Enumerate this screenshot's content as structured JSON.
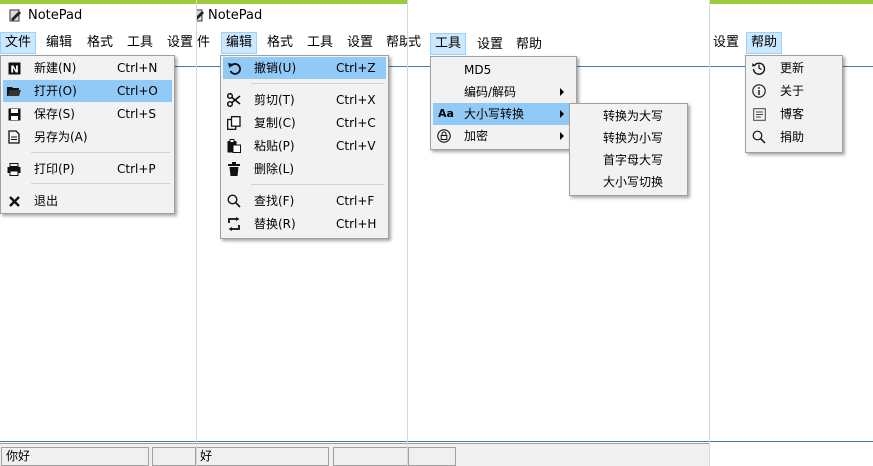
{
  "app": {
    "title": "NotePad",
    "status": "你好",
    "status_short": "好"
  },
  "menubar": {
    "file": "文件",
    "edit": "编辑",
    "format": "格式",
    "tools": "工具",
    "settings": "设置",
    "help": "帮助",
    "file_cut": "件",
    "format_cut": "式",
    "help_cut": "帮耳"
  },
  "file_menu": {
    "new": {
      "label": "新建(N)",
      "shortcut": "Ctrl+N"
    },
    "open": {
      "label": "打开(O)",
      "shortcut": "Ctrl+O"
    },
    "save": {
      "label": "保存(S)",
      "shortcut": "Ctrl+S"
    },
    "save_as": {
      "label": "另存为(A)"
    },
    "print": {
      "label": "打印(P)",
      "shortcut": "Ctrl+P"
    },
    "exit": {
      "label": "退出"
    }
  },
  "edit_menu": {
    "undo": {
      "label": "撤销(U)",
      "shortcut": "Ctrl+Z"
    },
    "cut": {
      "label": "剪切(T)",
      "shortcut": "Ctrl+X"
    },
    "copy": {
      "label": "复制(C)",
      "shortcut": "Ctrl+C"
    },
    "paste": {
      "label": "粘贴(P)",
      "shortcut": "Ctrl+V"
    },
    "delete": {
      "label": "删除(L)"
    },
    "find": {
      "label": "查找(F)",
      "shortcut": "Ctrl+F"
    },
    "replace": {
      "label": "替换(R)",
      "shortcut": "Ctrl+H"
    }
  },
  "tools_menu": {
    "md5": "MD5",
    "encode": "编码/解码",
    "case": "大小写转换",
    "case_icon": "Aa",
    "encrypt": "加密"
  },
  "case_submenu": {
    "upper": "转换为大写",
    "lower": "转换为小写",
    "capitalize": "首字母大写",
    "toggle": "大小写切换"
  },
  "help_menu": {
    "update": "更新",
    "about": "关于",
    "blog": "博客",
    "donate": "捐助"
  },
  "colors": {
    "highlight": "#91c9f7",
    "menu_active": "#cce8ff",
    "accent_line": "#9fc93c",
    "rule": "#3d7ab8"
  }
}
